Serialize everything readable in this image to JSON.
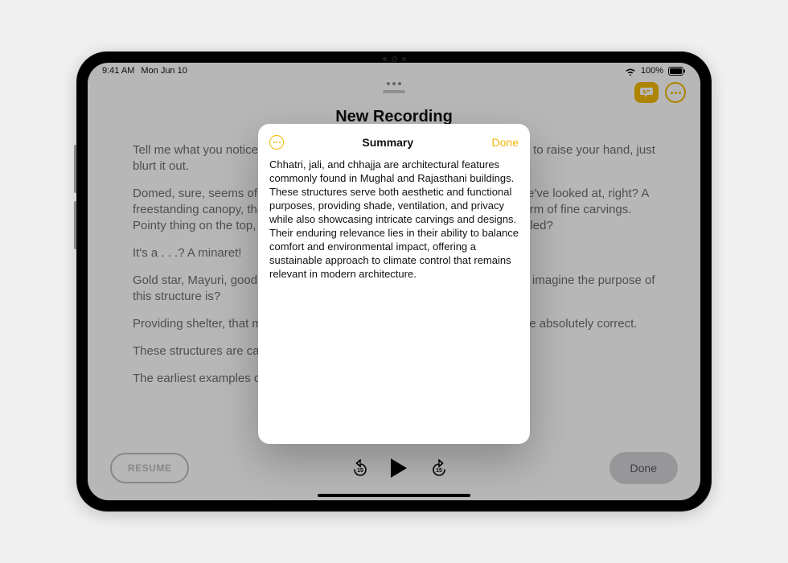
{
  "statusbar": {
    "time": "9:41 AM",
    "date": "Mon Jun 10",
    "battery": "100%"
  },
  "recording": {
    "title": "New Recording",
    "transcript": [
      "Tell me what you notice about this building. Don't wait for me to call on you to raise your hand, just blurt it out.",
      "Domed, sure, seems of a similar architectural structure as the other one we've looked at, right? A freestanding canopy, thank you. Yes, and they're very ornate, with some form of fine carvings. Pointy thing on the top, OK. Anyone remember what that pointy thing is called?",
      "It's a . . .? A minaret!",
      "Gold star, Mayuri, good remembering. OK, now what would you, forty-one, imagine the purpose of this structure is?",
      "Providing shelter, that makes sense, it's India, usually hot and sunny. You're absolutely correct.",
      "These structures are called chhatri, which is Hindi for umbrella.",
      "The earliest examples of . . .                                                         . . . Gujarat, but we"
    ],
    "resume_label": "RESUME",
    "done_label": "Done",
    "skip_back": "15",
    "skip_fwd": "15"
  },
  "modal": {
    "title": "Summary",
    "done_label": "Done",
    "body": "Chhatri, jali, and chhajja are architectural features commonly found in Mughal and Rajasthani buildings. These structures serve both aesthetic and functional purposes, providing shade, ventilation, and privacy while also showcasing intricate carvings and designs. Their enduring relevance lies in their ability to balance comfort and environmental impact, offering a sustainable approach to climate control that remains relevant in modern architecture."
  }
}
